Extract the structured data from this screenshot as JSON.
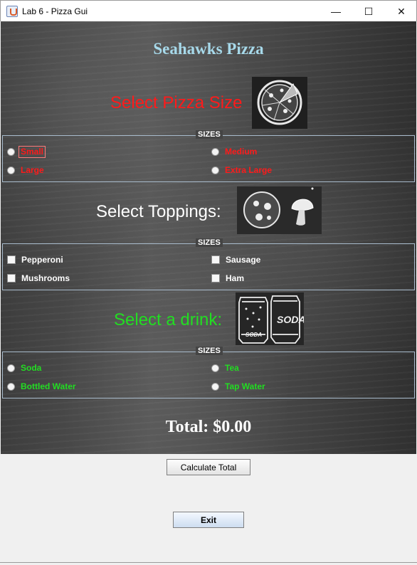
{
  "window": {
    "title": "Lab 6 - Pizza Gui",
    "minimize_glyph": "—",
    "maximize_glyph": "☐",
    "close_glyph": "✕"
  },
  "heading": {
    "shop_name": "Seahawks Pizza",
    "total": "Total: $0.00"
  },
  "sections": {
    "size_title": "Select Pizza Size",
    "toppings_title": "Select Toppings:",
    "drink_title": "Select a drink:"
  },
  "size_group": {
    "title": "SIZES",
    "options": [
      "Small",
      "Medium",
      "Large",
      "Extra Large"
    ]
  },
  "topping_group": {
    "title": "SIZES",
    "options": [
      "Pepperoni",
      "Sausage",
      "Mushrooms",
      "Ham"
    ]
  },
  "drink_group": {
    "title": "SIZES",
    "options": [
      "Soda",
      "Tea",
      "Bottled Water",
      "Tap Water"
    ]
  },
  "images": {
    "pizza_soda_label": "SODA"
  },
  "buttons": {
    "calculate": "Calculate Total",
    "exit": "Exit"
  },
  "icons": [
    "java-app-icon",
    "pizza-icon",
    "pepperoni-icon",
    "mushroom-icon",
    "soda-can-icon"
  ],
  "colors": {
    "shop_title": "#a7d9ea",
    "size_text": "#ff1a1a",
    "drink_text": "#22dd22",
    "topping_text": "#ffffff"
  }
}
